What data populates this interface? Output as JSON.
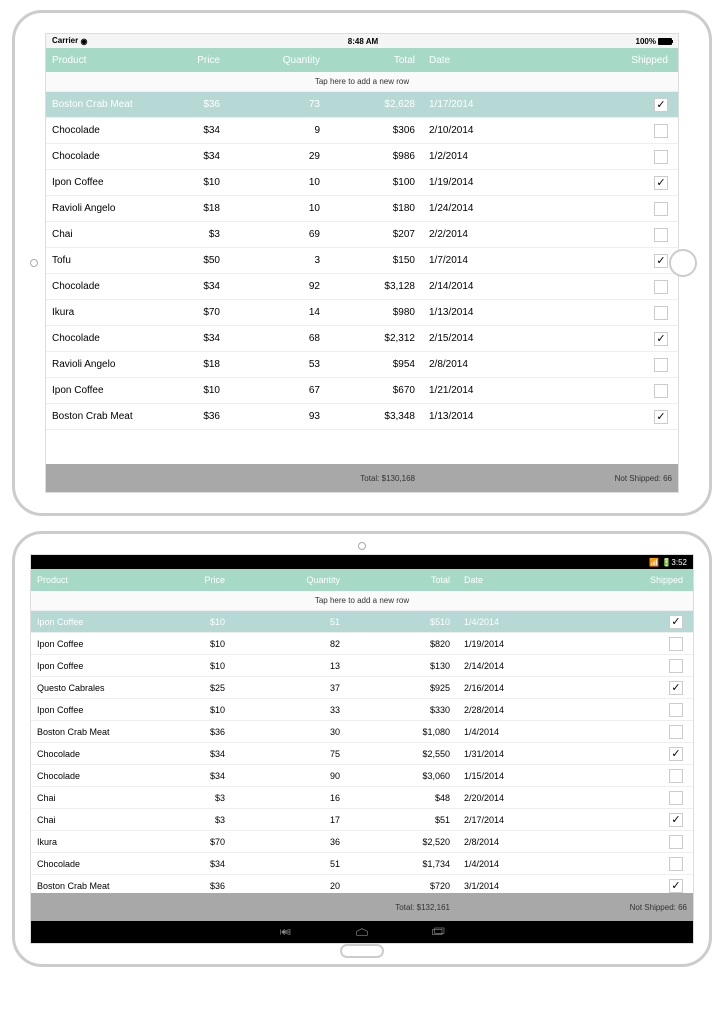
{
  "ipad": {
    "status": {
      "carrier": "Carrier",
      "time": "8:48 AM",
      "battery": "100%"
    },
    "headers": {
      "product": "Product",
      "price": "Price",
      "quantity": "Quantity",
      "total": "Total",
      "date": "Date",
      "shipped": "Shipped"
    },
    "add_row_text": "Tap here to add a new row",
    "rows": [
      {
        "product": "Boston Crab Meat",
        "price": "$36",
        "qty": "73",
        "total": "$2,628",
        "date": "1/17/2014",
        "shipped": true,
        "selected": true
      },
      {
        "product": "Chocolade",
        "price": "$34",
        "qty": "9",
        "total": "$306",
        "date": "2/10/2014",
        "shipped": false
      },
      {
        "product": "Chocolade",
        "price": "$34",
        "qty": "29",
        "total": "$986",
        "date": "1/2/2014",
        "shipped": false
      },
      {
        "product": "Ipon Coffee",
        "price": "$10",
        "qty": "10",
        "total": "$100",
        "date": "1/19/2014",
        "shipped": true
      },
      {
        "product": "Ravioli Angelo",
        "price": "$18",
        "qty": "10",
        "total": "$180",
        "date": "1/24/2014",
        "shipped": false
      },
      {
        "product": "Chai",
        "price": "$3",
        "qty": "69",
        "total": "$207",
        "date": "2/2/2014",
        "shipped": false
      },
      {
        "product": "Tofu",
        "price": "$50",
        "qty": "3",
        "total": "$150",
        "date": "1/7/2014",
        "shipped": true
      },
      {
        "product": "Chocolade",
        "price": "$34",
        "qty": "92",
        "total": "$3,128",
        "date": "2/14/2014",
        "shipped": false
      },
      {
        "product": "Ikura",
        "price": "$70",
        "qty": "14",
        "total": "$980",
        "date": "1/13/2014",
        "shipped": false
      },
      {
        "product": "Chocolade",
        "price": "$34",
        "qty": "68",
        "total": "$2,312",
        "date": "2/15/2014",
        "shipped": true
      },
      {
        "product": "Ravioli Angelo",
        "price": "$18",
        "qty": "53",
        "total": "$954",
        "date": "2/8/2014",
        "shipped": false
      },
      {
        "product": "Ipon Coffee",
        "price": "$10",
        "qty": "67",
        "total": "$670",
        "date": "1/21/2014",
        "shipped": false
      },
      {
        "product": "Boston Crab Meat",
        "price": "$36",
        "qty": "93",
        "total": "$3,348",
        "date": "1/13/2014",
        "shipped": true
      }
    ],
    "footer": {
      "total_label": "Total: $130,168",
      "not_shipped": "Not Shipped: 66"
    }
  },
  "android": {
    "status": {
      "time": "3:52"
    },
    "headers": {
      "product": "Product",
      "price": "Price",
      "quantity": "Quantity",
      "total": "Total",
      "date": "Date",
      "shipped": "Shipped"
    },
    "add_row_text": "Tap here to add a new row",
    "rows": [
      {
        "product": "Ipon Coffee",
        "price": "$10",
        "qty": "51",
        "total": "$510",
        "date": "1/4/2014",
        "shipped": true,
        "selected": true
      },
      {
        "product": "Ipon Coffee",
        "price": "$10",
        "qty": "82",
        "total": "$820",
        "date": "1/19/2014",
        "shipped": false
      },
      {
        "product": "Ipon Coffee",
        "price": "$10",
        "qty": "13",
        "total": "$130",
        "date": "2/14/2014",
        "shipped": false
      },
      {
        "product": "Questo Cabrales",
        "price": "$25",
        "qty": "37",
        "total": "$925",
        "date": "2/16/2014",
        "shipped": true
      },
      {
        "product": "Ipon Coffee",
        "price": "$10",
        "qty": "33",
        "total": "$330",
        "date": "2/28/2014",
        "shipped": false
      },
      {
        "product": "Boston Crab Meat",
        "price": "$36",
        "qty": "30",
        "total": "$1,080",
        "date": "1/4/2014",
        "shipped": false
      },
      {
        "product": "Chocolade",
        "price": "$34",
        "qty": "75",
        "total": "$2,550",
        "date": "1/31/2014",
        "shipped": true
      },
      {
        "product": "Chocolade",
        "price": "$34",
        "qty": "90",
        "total": "$3,060",
        "date": "1/15/2014",
        "shipped": false
      },
      {
        "product": "Chai",
        "price": "$3",
        "qty": "16",
        "total": "$48",
        "date": "2/20/2014",
        "shipped": false
      },
      {
        "product": "Chai",
        "price": "$3",
        "qty": "17",
        "total": "$51",
        "date": "2/17/2014",
        "shipped": true
      },
      {
        "product": "Ikura",
        "price": "$70",
        "qty": "36",
        "total": "$2,520",
        "date": "2/8/2014",
        "shipped": false
      },
      {
        "product": "Chocolade",
        "price": "$34",
        "qty": "51",
        "total": "$1,734",
        "date": "1/4/2014",
        "shipped": false
      },
      {
        "product": "Boston Crab Meat",
        "price": "$36",
        "qty": "20",
        "total": "$720",
        "date": "3/1/2014",
        "shipped": true
      }
    ],
    "footer": {
      "total_label": "Total: $132,161",
      "not_shipped": "Not Shipped: 66"
    }
  }
}
